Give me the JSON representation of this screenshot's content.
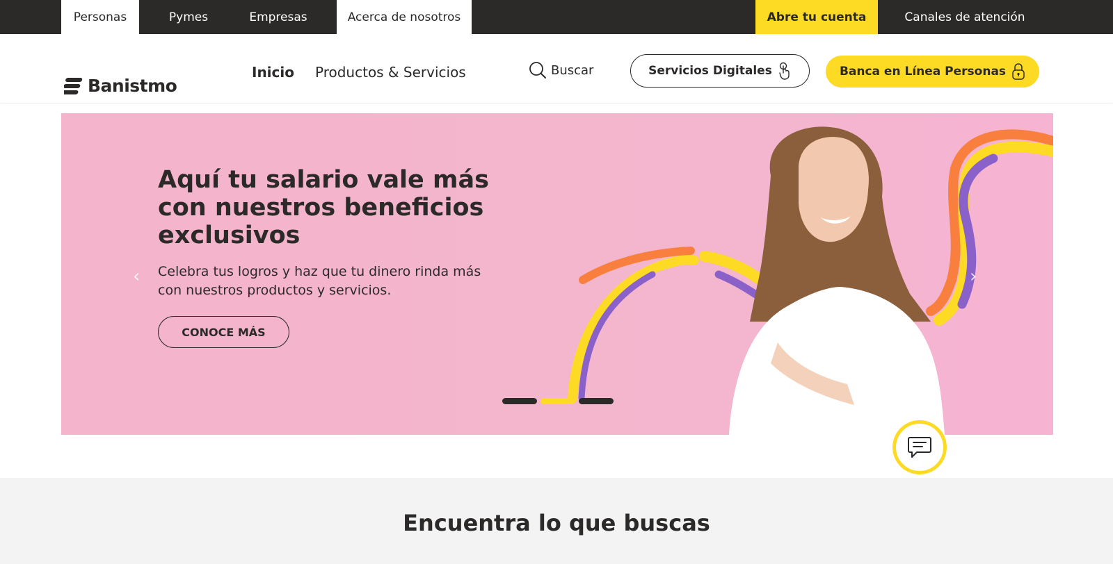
{
  "topbar": {
    "tabs": [
      {
        "label": "Personas"
      },
      {
        "label": "Pymes"
      },
      {
        "label": "Empresas"
      },
      {
        "label": "Acerca de nosotros"
      }
    ],
    "open_account": "Abre tu cuenta",
    "channels": "Canales de atención"
  },
  "header": {
    "logo_text": "Banistmo",
    "nav": [
      {
        "label": "Inicio"
      },
      {
        "label": "Productos & Servicios"
      }
    ],
    "search_label": "Buscar",
    "digital_services": "Servicios Digitales",
    "online_banking": "Banca en Línea Personas"
  },
  "hero": {
    "title": "Aquí tu salario vale más con nuestros beneficios exclusivos",
    "description": "Celebra tus logros y haz que tu dinero rinda más con nuestros productos y servicios.",
    "cta": "CONOCE MÁS",
    "prev": "‹",
    "next": "›",
    "slides": 3,
    "active_slide": 2
  },
  "section": {
    "title": "Encuentra lo que buscas"
  },
  "colors": {
    "brand_yellow": "#fdda24",
    "dark": "#2c2a29",
    "hero_pink": "#f4b4cc",
    "section_bg": "#f3f3f3"
  }
}
